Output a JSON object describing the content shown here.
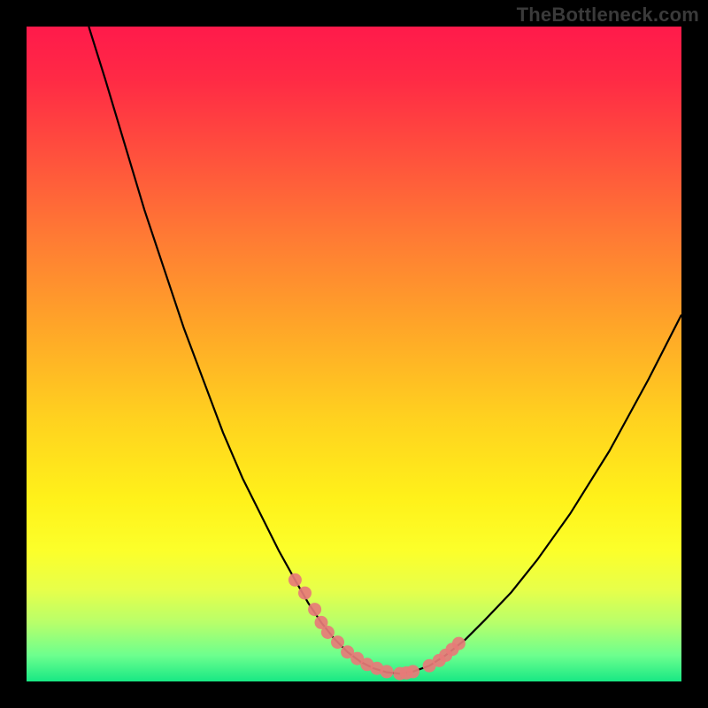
{
  "watermark": "TheBottleneck.com",
  "colors": {
    "frame": "#000000",
    "curve": "#000000",
    "marker": "#e77b78",
    "watermark": "#3a3a3a"
  },
  "chart_data": {
    "type": "line",
    "title": "",
    "xlabel": "",
    "ylabel": "",
    "xlim": [
      0,
      100
    ],
    "ylim": [
      0,
      100
    ],
    "grid": false,
    "legend": false,
    "series": [
      {
        "name": "bottleneck-curve",
        "x": [
          9.5,
          12,
          15,
          18,
          21,
          24,
          27,
          30,
          33,
          36,
          38.5,
          41,
          43,
          45,
          47,
          49,
          51,
          53,
          55,
          57,
          59,
          61.5,
          64,
          67,
          70,
          74,
          78,
          83,
          89,
          95,
          100
        ],
        "y": [
          100,
          92,
          82,
          72,
          63,
          54,
          46,
          38,
          31,
          25,
          20,
          15.5,
          12,
          9,
          6.5,
          4.5,
          3,
          2,
          1.4,
          1.2,
          1.5,
          2.4,
          4,
          6.4,
          9.4,
          13.6,
          18.6,
          25.6,
          35.2,
          46.2,
          56
        ]
      }
    ],
    "markers": {
      "name": "highlighted-points",
      "x": [
        41,
        42.5,
        44,
        45,
        46,
        47.5,
        49,
        50.5,
        52,
        53.5,
        55,
        57,
        58,
        59,
        61.5,
        63,
        64,
        65,
        66
      ],
      "y": [
        15.5,
        13.5,
        11,
        9,
        7.5,
        6,
        4.5,
        3.5,
        2.6,
        2,
        1.5,
        1.2,
        1.3,
        1.5,
        2.4,
        3.2,
        4,
        4.9,
        5.8
      ]
    }
  }
}
